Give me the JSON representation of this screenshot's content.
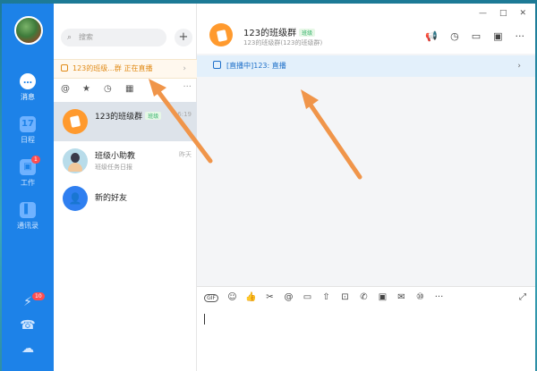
{
  "rail": {
    "items": [
      {
        "label": "消息",
        "icon": "chat-icon",
        "glyph": "…"
      },
      {
        "label": "日程",
        "icon": "calendar-icon",
        "glyph": "17"
      },
      {
        "label": "工作",
        "icon": "apps-icon",
        "glyph": "▣",
        "badge": "1"
      },
      {
        "label": "通讯录",
        "icon": "contacts-icon",
        "glyph": "▌"
      }
    ],
    "bottom": [
      {
        "icon": "lightning-icon",
        "glyph": "⚡",
        "badge": "10"
      },
      {
        "icon": "phone-icon",
        "glyph": "☎"
      },
      {
        "icon": "cloud-icon",
        "glyph": "☁"
      }
    ]
  },
  "list": {
    "search_placeholder": "搜索",
    "plus": "+",
    "live_banner": "123的班级...群 正在直播",
    "filters": [
      "@",
      "★",
      "◷",
      "▦",
      "···"
    ],
    "conversations": [
      {
        "name": "123的班级群",
        "tag": "班级",
        "time": "16:19",
        "sub": ""
      },
      {
        "name": "班级小助教",
        "tag": "",
        "time": "昨天",
        "sub": "班级任务日报"
      },
      {
        "name": "新的好友",
        "tag": "",
        "time": "",
        "sub": ""
      }
    ]
  },
  "chat": {
    "title": "123的班级群",
    "tag": "班级",
    "subtitle": "123的班级群(123的班级群)",
    "window_controls": [
      "—",
      "□",
      "✕"
    ],
    "tools": [
      "📢",
      "◷",
      "▭",
      "▣",
      "···"
    ],
    "live_bar": "[直播中]123: 直播",
    "composer_tools": [
      "GIF",
      "☺",
      "👍",
      "✂",
      "@",
      "▭",
      "⇧",
      "⊡",
      "✆",
      "▣",
      "✉",
      "⑩",
      "···"
    ],
    "expand": "⤢"
  },
  "colors": {
    "rail": "#1d82e8",
    "live_orange": "#e08a16",
    "live_blue": "#1d6fc9",
    "arrow": "#f0954a"
  }
}
